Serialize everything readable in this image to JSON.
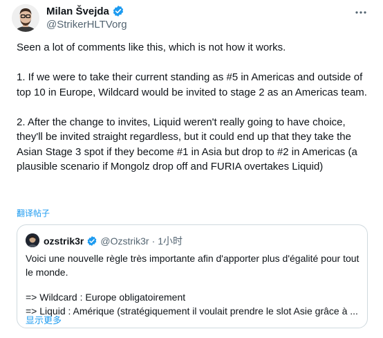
{
  "author": {
    "name": "Milan Švejda",
    "handle": "@StrikerHLTVorg",
    "verified": true,
    "verified_color": "#1d9bf0"
  },
  "tweet": {
    "paragraphs": [
      "Seen a lot of comments like this, which is not how it works.",
      "1. If we were to take their current standing as #5 in Americas and outside of top 10 in Europe, Wildcard would be invited to stage 2 as an Americas team.",
      "2. After the change to invites, Liquid weren't really going to have choice, they'll be invited straight regardless, but it could end up that they take the Asian Stage 3 spot if they become #1 in Asia but drop to #2 in Americas (a plausible scenario if Mongolz drop off and FURIA overtakes Liquid)"
    ],
    "translate_label": "翻译帖子"
  },
  "quote": {
    "name": "ozstrik3r",
    "handle": "@Ozstrik3r",
    "separator": "·",
    "time": "1小时",
    "verified": true,
    "lines": [
      "Voici une nouvelle règle très importante afin d'apporter plus d'égalité pour tout",
      "le monde.",
      "",
      "=> Wildcard : Europe obligatoirement",
      "=> Liquid : Amérique (stratégiquement il voulait prendre le slot Asie grâce à ..."
    ],
    "show_more_label": "显示更多"
  },
  "icons": {
    "more": "more-horizontal-icon",
    "verified": "verified-badge-icon"
  },
  "colors": {
    "link": "#1d9bf0",
    "muted": "#536471",
    "border": "#cfd9de"
  }
}
